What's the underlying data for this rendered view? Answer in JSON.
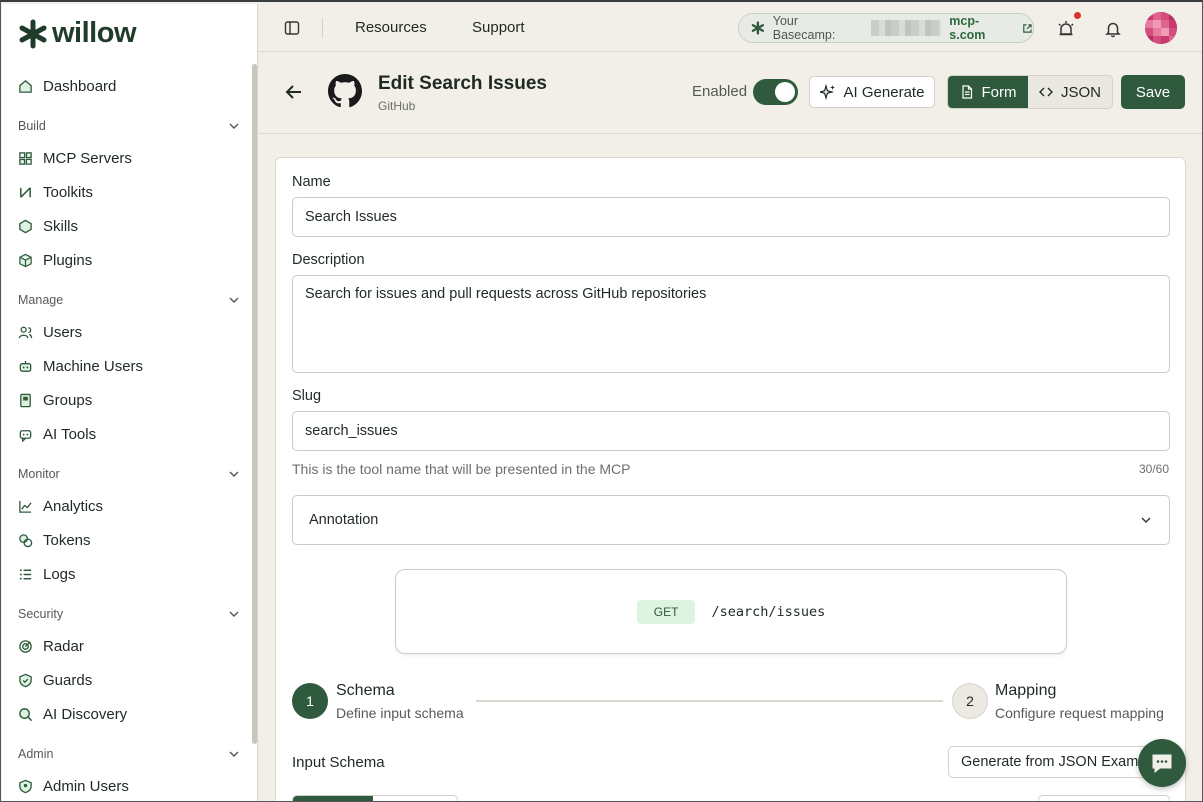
{
  "app": {
    "logo_text": "willow"
  },
  "sidebar": {
    "dashboard": "Dashboard",
    "sections": [
      {
        "title": "Build",
        "items": [
          {
            "label": "MCP Servers",
            "icon": "servers-icon"
          },
          {
            "label": "Toolkits",
            "icon": "toolkit-icon"
          },
          {
            "label": "Skills",
            "icon": "hexagon-icon"
          },
          {
            "label": "Plugins",
            "icon": "cube-icon"
          }
        ]
      },
      {
        "title": "Manage",
        "items": [
          {
            "label": "Users",
            "icon": "users-icon"
          },
          {
            "label": "Machine Users",
            "icon": "robot-icon"
          },
          {
            "label": "Groups",
            "icon": "book-icon"
          },
          {
            "label": "AI Tools",
            "icon": "bot-icon"
          }
        ]
      },
      {
        "title": "Monitor",
        "items": [
          {
            "label": "Analytics",
            "icon": "chart-icon"
          },
          {
            "label": "Tokens",
            "icon": "coins-icon"
          },
          {
            "label": "Logs",
            "icon": "list-icon"
          }
        ]
      },
      {
        "title": "Security",
        "items": [
          {
            "label": "Radar",
            "icon": "radar-icon"
          },
          {
            "label": "Guards",
            "icon": "shield-icon"
          },
          {
            "label": "AI Discovery",
            "icon": "search-icon"
          }
        ]
      },
      {
        "title": "Admin",
        "items": [
          {
            "label": "Admin Users",
            "icon": "shield-user-icon"
          }
        ]
      }
    ]
  },
  "topbar": {
    "links": [
      "Resources",
      "Support"
    ],
    "basecamp_label": "Your Basecamp:",
    "basecamp_domain": "mcp-s.com"
  },
  "header": {
    "title": "Edit Search Issues",
    "subtitle": "GitHub",
    "enabled_label": "Enabled",
    "enabled": true,
    "ai_generate": "AI Generate",
    "view_form": "Form",
    "view_json": "JSON",
    "active_view": "Form",
    "save": "Save"
  },
  "form": {
    "name_label": "Name",
    "name_value": "Search Issues",
    "description_label": "Description",
    "description_value": "Search for issues and pull requests across GitHub repositories",
    "slug_label": "Slug",
    "slug_value": "search_issues",
    "slug_helper": "This is the tool name that will be presented in the MCP",
    "slug_counter": "30/60",
    "annotation_label": "Annotation"
  },
  "endpoint": {
    "method": "GET",
    "path": "/search/issues"
  },
  "steps": [
    {
      "number": "1",
      "title": "Schema",
      "description": "Define input schema",
      "active": true
    },
    {
      "number": "2",
      "title": "Mapping",
      "description": "Configure request mapping",
      "active": false
    }
  ],
  "schema": {
    "label": "Input Schema",
    "generate_button": "Generate from JSON Example"
  },
  "colors": {
    "brand": "#2f5a3d",
    "method_bg": "#dff3e3",
    "notification": "#e0312b"
  }
}
